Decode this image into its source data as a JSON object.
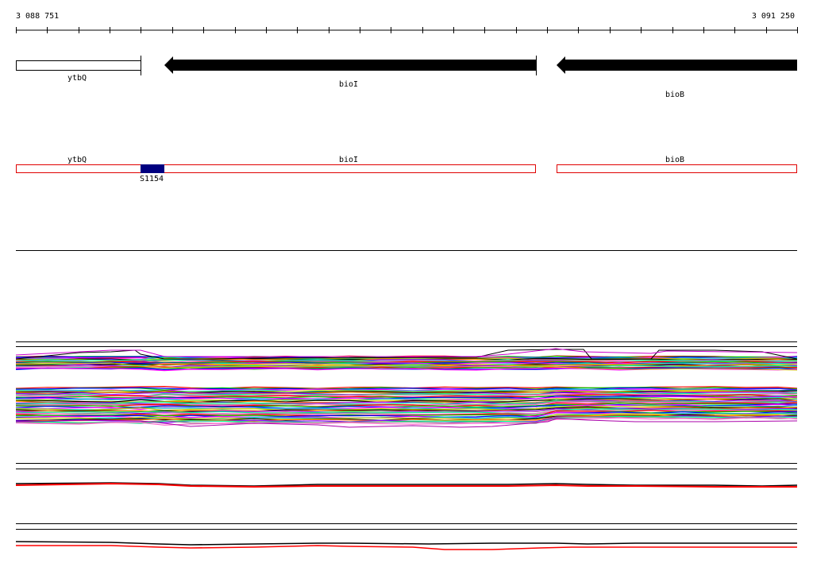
{
  "browser": {
    "coords": {
      "start": "3 088 751",
      "end": "3 091 250"
    },
    "genes": [
      {
        "name": "ytbQ",
        "strand": "none"
      },
      {
        "name": "bioI",
        "strand": "-"
      },
      {
        "name": "bioB",
        "strand": "-"
      }
    ],
    "segments": [
      {
        "name": "ytbQ"
      },
      {
        "name": "bioI"
      },
      {
        "name": "bioB"
      }
    ],
    "feature": {
      "name": "S1154",
      "color": "#000080"
    }
  },
  "colors": {
    "gene_arrow": "#000000",
    "segment_outline": "#e00000",
    "ruler": "#000000",
    "expression_palette": [
      "#ff0000",
      "#00cc00",
      "#0000ff",
      "#ff00ff",
      "#00cccc",
      "#cccc00",
      "#000000",
      "#ff8800",
      "#8800ff",
      "#00ff88",
      "#888888",
      "#ff66cc"
    ],
    "summary_red": "#ff0000",
    "summary_black": "#000000"
  }
}
